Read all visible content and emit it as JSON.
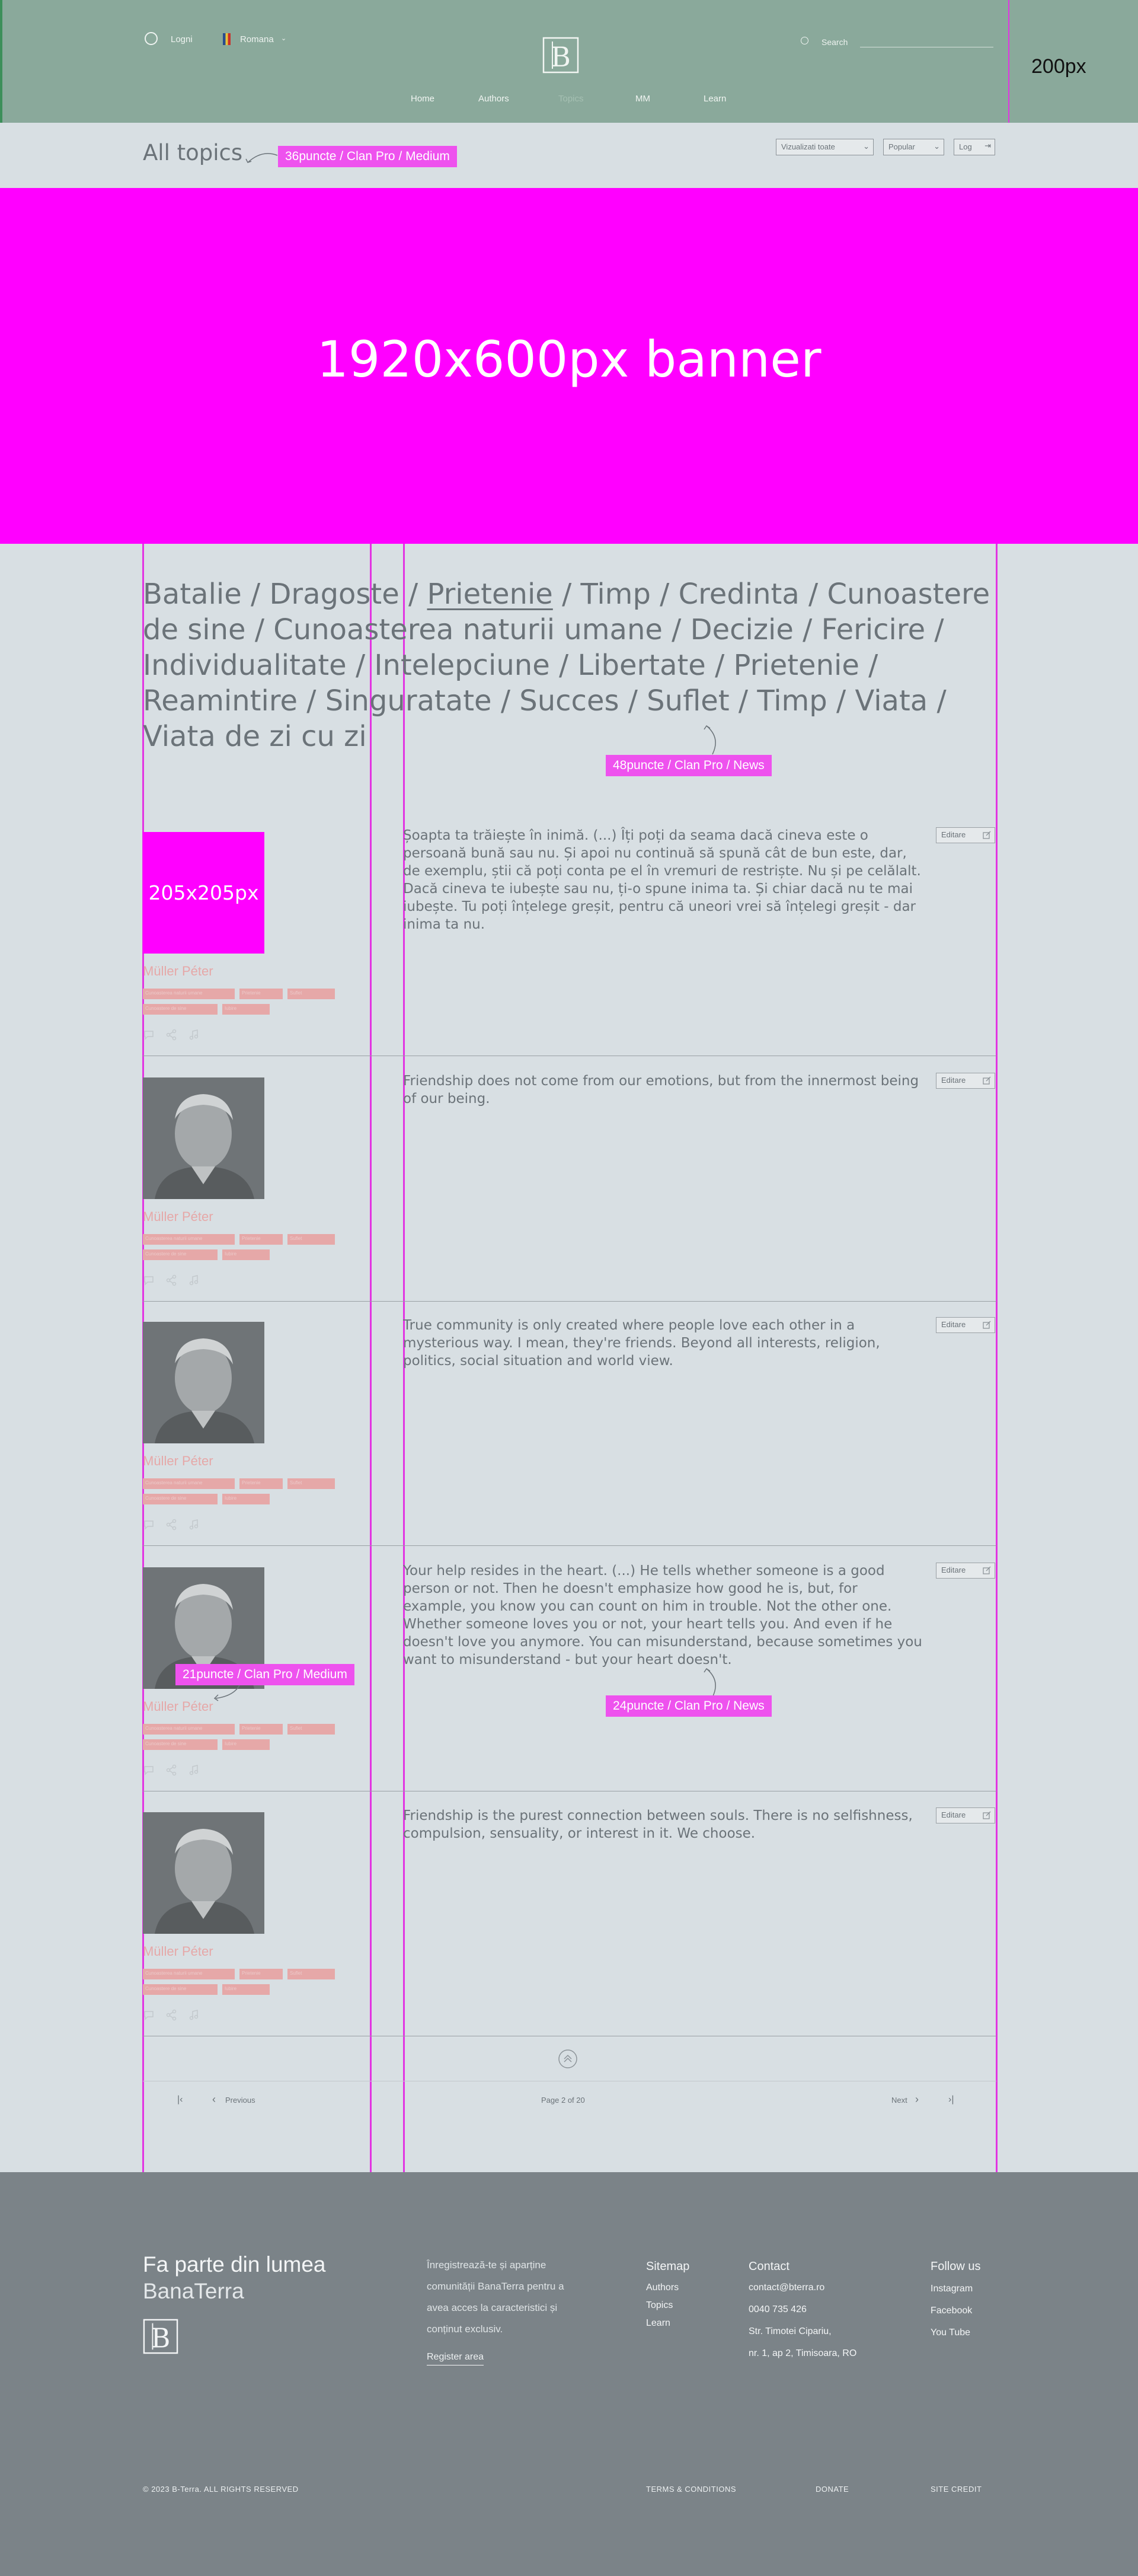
{
  "header": {
    "login": "Logni",
    "language": "Romana",
    "search_label": "Search",
    "nav": [
      "Home",
      "Authors",
      "Topics",
      "MM",
      "Learn"
    ],
    "height_note": "200px"
  },
  "topics_bar": {
    "title": "All topics",
    "title_callout": "36puncte / Clan Pro / Medium",
    "filters": [
      "Vizualizati toate",
      "Popular",
      "Log"
    ],
    "height_note": "75px"
  },
  "banner": {
    "label": "1920x600px banner"
  },
  "topics": {
    "items": [
      "Batalie",
      "Dragoste",
      "Prietenie",
      "Timp",
      "Credinta",
      "Cunoastere de sine",
      "Cunoasterea naturii umane",
      "Decizie",
      "Fericire",
      "Individualitate",
      "Intelepciune",
      "Libertate",
      "Prietenie",
      "Reamintire",
      "Singuratate",
      "Succes",
      "Suflet",
      " Timp",
      "Viata",
      "Viata de zi cu zi"
    ],
    "active_index": 2,
    "callout": "48puncte / Clan Pro / News"
  },
  "quotes": {
    "photo_placeholder": "205x205px",
    "edit_label": "Editare",
    "author_callout": "21puncte / Clan Pro / Medium",
    "text_callout": "24puncte / Clan Pro / News",
    "tag_labels": [
      "Cunoasterea naturii umane",
      "Prietenie",
      "Suflet",
      "Cunoastere de sine",
      "Iubire"
    ],
    "items": [
      {
        "author": "Müller Péter",
        "text": "Șoapta ta trăiește în inimă. (...) Îți poți da seama dacă cineva este o persoană bună sau nu. Și apoi nu continuă să spună cât de bun este, dar, de exemplu, știi că poți conta pe el în vremuri de restriște. Nu și pe celălalt. Dacă cineva te iubește sau nu, ți-o spune inima ta. Și chiar dacă nu te mai iubește. Tu poți înțelege greșit, pentru că uneori vrei să înțelegi greșit - dar inima ta nu."
      },
      {
        "author": "Müller Péter",
        "text": "Friendship does not come from our emotions, but from the innermost being of our being."
      },
      {
        "author": "Müller Péter",
        "text": "True community is only created where people love each other in a mysterious way. I mean, they're friends. Beyond all interests, religion, politics, social situation and world view."
      },
      {
        "author": "Müller Péter",
        "text": "Your help resides in the heart. (...) He tells whether someone is a good person or not. Then he doesn't emphasize how good he is, but, for example, you know you can count on him in trouble. Not the other one. Whether someone loves you or not, your heart tells you. And even if he doesn't love you anymore. You can misunderstand, because sometimes you want to misunderstand - but your heart doesn't."
      },
      {
        "author": "Müller Péter",
        "text": "Friendship is the purest connection between souls. There is no selfishness, compulsion, sensuality, or interest in it. We choose."
      }
    ]
  },
  "pagination": {
    "previous": "Previous",
    "page_info": "Page 2 of 20",
    "next": "Next"
  },
  "footer": {
    "headline_line1": "Fa parte din lumea",
    "headline_line2": "BanaTerra",
    "blurb": [
      "Înregistrează-te și aparține",
      "comunității BanaTerra pentru a",
      "avea acces la caracteristici și",
      "conținut exclusiv."
    ],
    "register": "Register area",
    "sitemap_title": "Sitemap",
    "sitemap": [
      "Authors",
      "Topics",
      "Learn"
    ],
    "contact_title": "Contact",
    "contact": [
      "contact@bterra.ro",
      "0040 735 426",
      "Str. Timotei Cipariu,",
      "nr. 1, ap 2, Timisoara, RO"
    ],
    "follow_title": "Follow us",
    "follow": [
      "Instagram",
      "Facebook",
      "You Tube"
    ],
    "copyright": "© 2023 B-Terra. ALL RIGHTS RESERVED",
    "terms": "TERMS & CONDITIONS",
    "donate": "DONATE",
    "credit": "SITE CREDIT"
  },
  "colors": {
    "accent": "#ff00ff",
    "header_bg": "#8aa99b",
    "footer_bg": "#7b8388",
    "page_bg": "#d8dfe3"
  }
}
